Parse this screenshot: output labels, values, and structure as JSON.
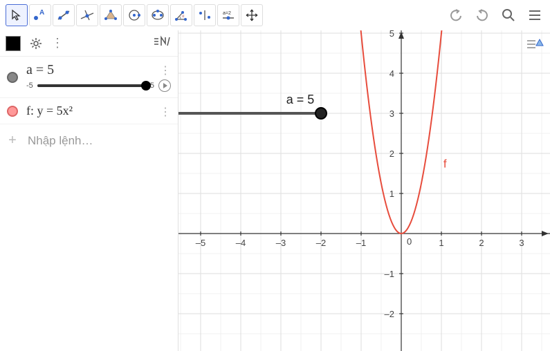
{
  "toolbar": {
    "tools": [
      "pointer",
      "point",
      "line",
      "perpendicular",
      "polygon",
      "circle",
      "ellipse",
      "angle",
      "reflect",
      "slider",
      "move"
    ]
  },
  "sidebar": {
    "objects": [
      {
        "label": "a = 5",
        "min": "-5",
        "max": "5",
        "value": 5,
        "color": "gray",
        "range_min": -5,
        "range_max": 5
      },
      {
        "label": "f: y = 5x²",
        "color": "red"
      }
    ],
    "input_placeholder": "Nhập lệnh…"
  },
  "graph": {
    "slider_label": "a = 5",
    "func_label": "f",
    "x_ticks": [
      "–5",
      "–4",
      "–3",
      "–2",
      "–1",
      "0",
      "1",
      "2",
      "3"
    ],
    "y_ticks_pos": [
      "1",
      "2",
      "3",
      "4",
      "5"
    ],
    "y_ticks_neg": [
      "–1",
      "–2"
    ],
    "x_origin": 580,
    "y_origin": 338,
    "unit": 58
  },
  "chart_data": {
    "type": "line",
    "title": "",
    "xlabel": "",
    "ylabel": "",
    "xlim": [
      -5.5,
      3.5
    ],
    "ylim": [
      -2.5,
      5.5
    ],
    "series": [
      {
        "name": "f",
        "formula": "y = 5x^2",
        "x": [
          -1.0,
          -0.8,
          -0.6,
          -0.4,
          -0.2,
          0,
          0.2,
          0.4,
          0.6,
          0.8,
          1.0
        ],
        "y": [
          5.0,
          3.2,
          1.8,
          0.8,
          0.2,
          0,
          0.2,
          0.8,
          1.8,
          3.2,
          5.0
        ]
      }
    ],
    "sliders": [
      {
        "name": "a",
        "value": 5,
        "min": -5,
        "max": 5,
        "display_x_range": [
          -5,
          -2
        ],
        "display_y": 3
      }
    ]
  }
}
